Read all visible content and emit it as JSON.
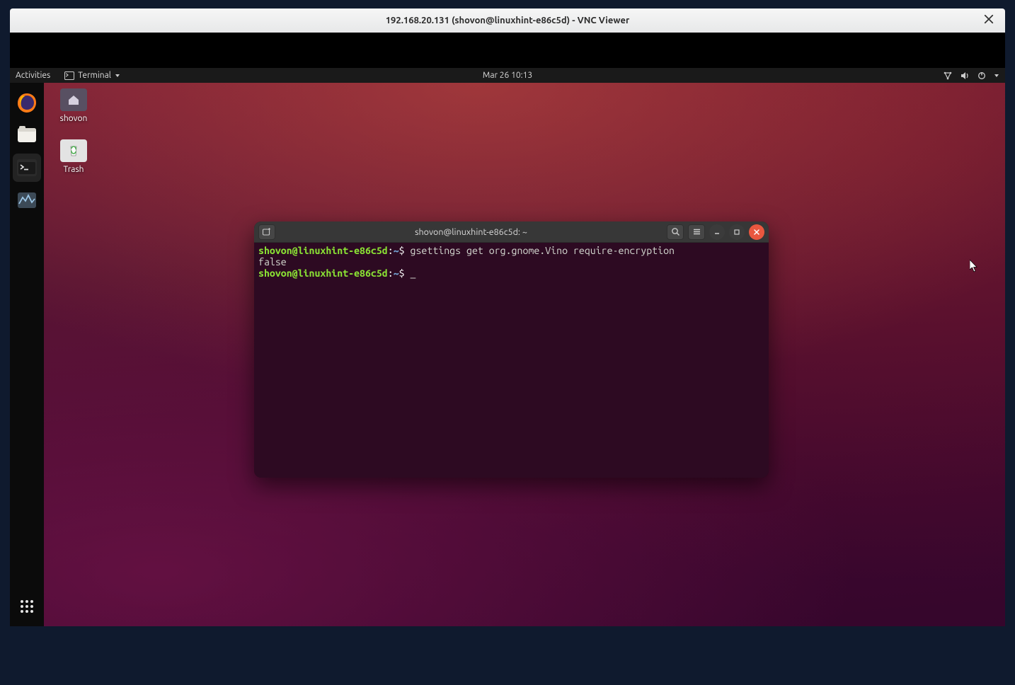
{
  "vnc": {
    "title": "192.168.20.131 (shovon@linuxhint-e86c5d) - VNC Viewer"
  },
  "topbar": {
    "activities": "Activities",
    "appmenu": "Terminal",
    "clock": "Mar 26  10:13"
  },
  "desktop_icons": {
    "home": "shovon",
    "trash": "Trash"
  },
  "terminal": {
    "title": "shovon@linuxhint-e86c5d: ~",
    "prompt_user": "shovon@linuxhint-e86c5d",
    "prompt_sep1": ":",
    "prompt_path": "~",
    "prompt_sep2": "$ ",
    "line1_cmd": "gsettings get org.gnome.Vino require-encryption",
    "line2_output": "false",
    "line3_cursor": "_"
  }
}
